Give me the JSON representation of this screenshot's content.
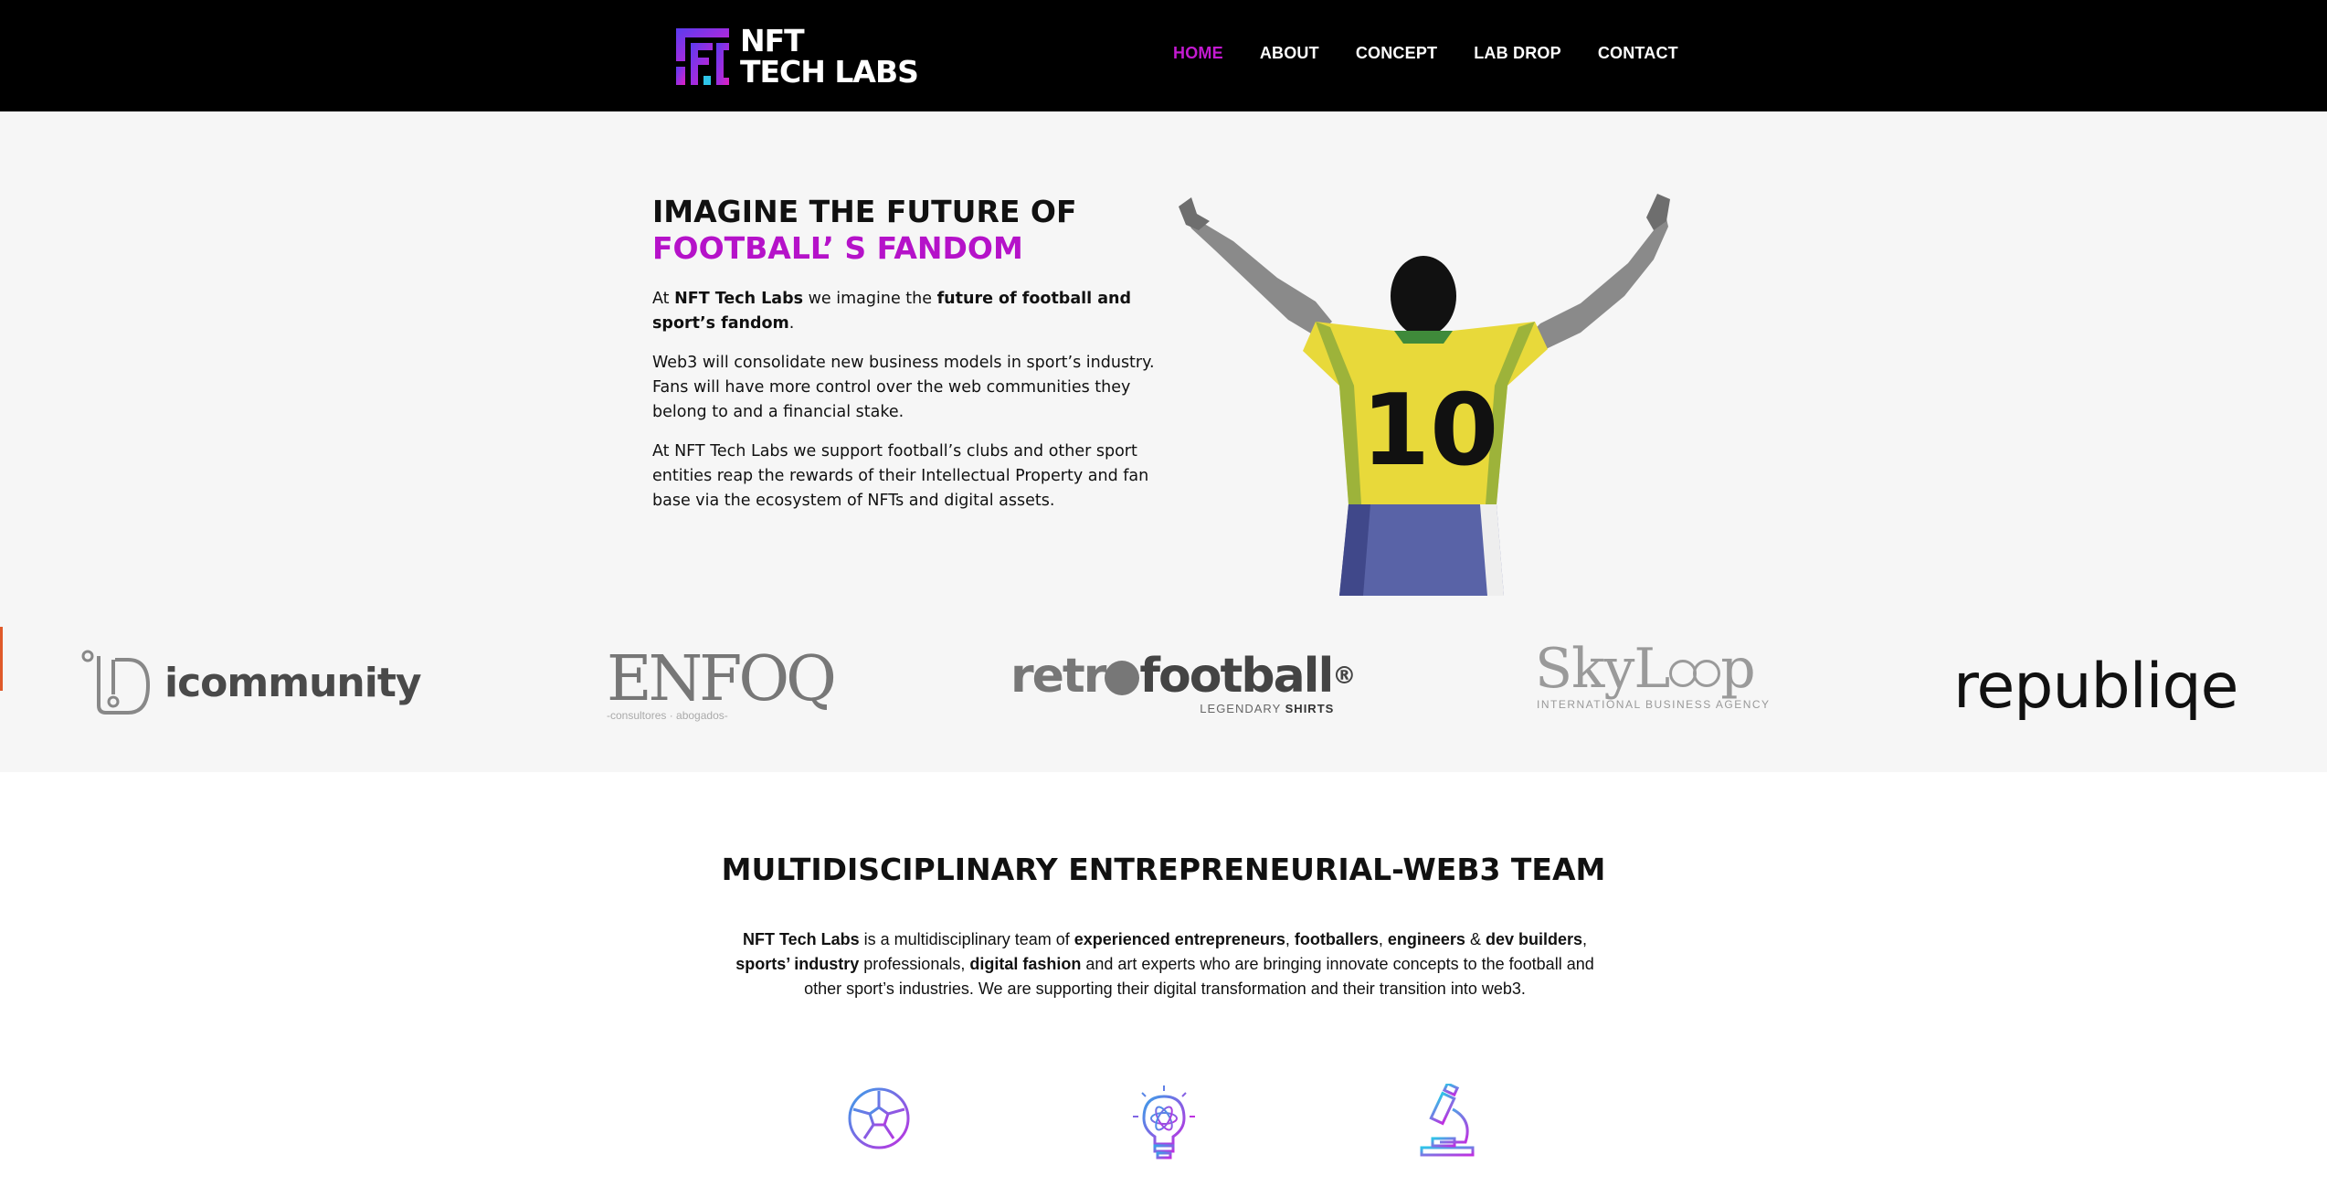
{
  "header": {
    "logo_line1": "NFT",
    "logo_line2": "TECH LABS",
    "nav": [
      {
        "label": "HOME",
        "active": true
      },
      {
        "label": "ABOUT",
        "active": false
      },
      {
        "label": "CONCEPT",
        "active": false
      },
      {
        "label": "LAB DROP",
        "active": false
      },
      {
        "label": "CONTACT",
        "active": false
      }
    ]
  },
  "hero": {
    "title_line1": "IMAGINE THE FUTURE OF",
    "title_line2": "FOOTBALL’ S FANDOM",
    "p1_a": "At ",
    "p1_b": "NFT Tech Labs",
    "p1_c": " we imagine the ",
    "p1_d": "future of football and sport’s fandom",
    "p1_e": ".",
    "p2": "Web3 will consolidate new business models in sport’s industry. Fans will have more control over the web communities they belong to and a financial stake.",
    "p3": "At NFT Tech Labs we support football’s clubs and other sport entities reap the rewards of their Intellectual Property and fan base via the ecosystem of NFTs and digital assets.",
    "jersey_number": "10"
  },
  "partners": {
    "icommunity": "icommunity",
    "enfoq": "ENFOQ",
    "enfoq_sub": "-consultores · abogados-",
    "retro_a": "retr",
    "retro_b": "football",
    "retro_reg": "®",
    "retro_sub_a": "LEGENDARY ",
    "retro_sub_b": "SHIRTS",
    "skyloop_a": "SkyL",
    "skyloop_b": "p",
    "skyloop_sub": "INTERNATIONAL BUSINESS AGENCY",
    "republiqe": "republiqe"
  },
  "team": {
    "title": "MULTIDISCIPLINARY ENTREPRENEURIAL-WEB3 TEAM",
    "t1": "NFT Tech Labs",
    "t2": "  is  a multidisciplinary team of ",
    "t3": "experienced entrepreneurs",
    "t4": ", ",
    "t5": "footballers",
    "t6": ", ",
    "t7": "engineers",
    "t8": " & ",
    "t9": "dev builders",
    "t10": ", ",
    "t11": "sports’ industry",
    "t12": " professionals, ",
    "t13": "digital fashion",
    "t14": " and art experts who are bringing innovate concepts to the football and other sport’s industries. We are supporting their digital transformation and their transition into web3."
  },
  "icons": [
    "soccer-ball-icon",
    "lightbulb-atom-icon",
    "microscope-icon"
  ],
  "colors": {
    "accent": "#c41ad1",
    "header_bg": "#000000",
    "hero_bg": "#f6f6f6"
  }
}
